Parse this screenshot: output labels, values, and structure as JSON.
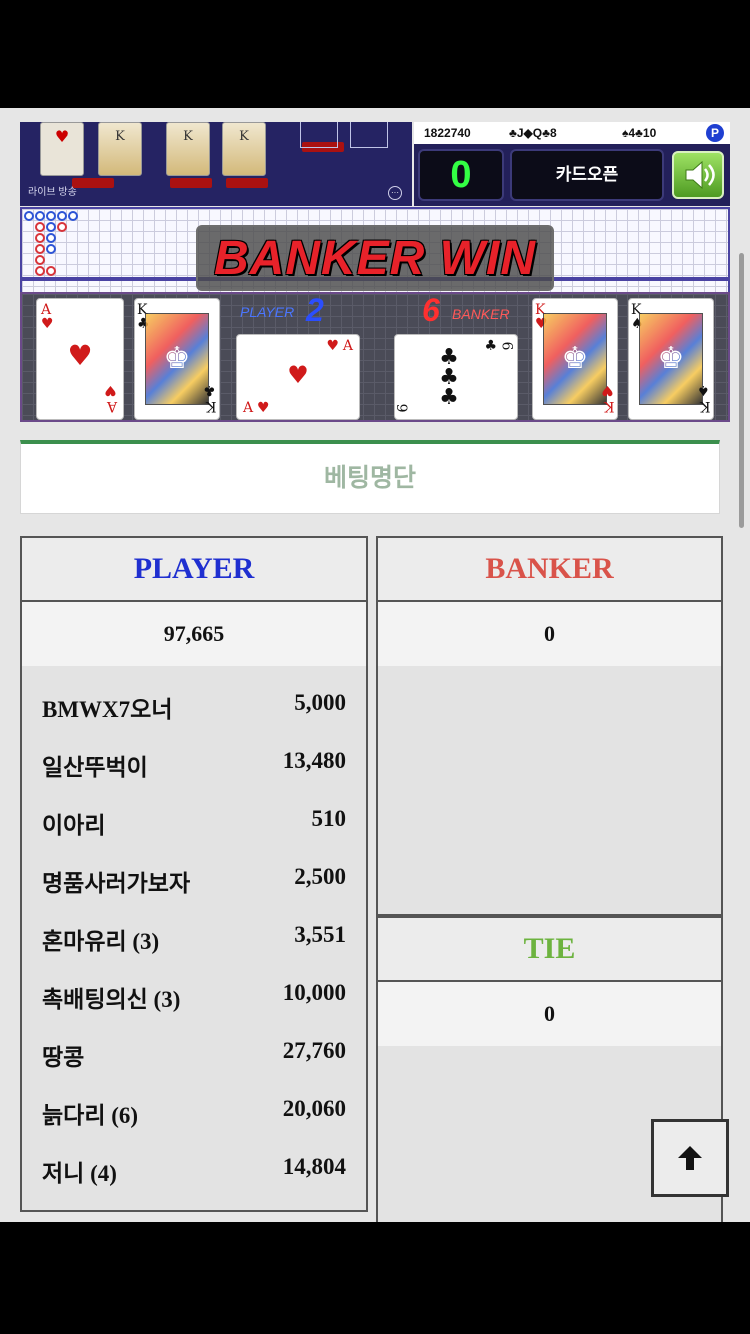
{
  "game": {
    "broadcast_label": "라이브 방송",
    "round_id": "1822740",
    "history_1": "♣J◆Q♣8",
    "history_2": "♠4♣10",
    "p_badge": "P",
    "countdown": "0",
    "card_open_label": "카드오픈",
    "result_text": "BANKER WIN",
    "player_label": "PLAYER",
    "player_score": "2",
    "banker_label": "BANKER",
    "banker_score": "6",
    "player_cards": [
      {
        "rank": "A",
        "suit": "♥",
        "color": "#d01a1a"
      },
      {
        "rank": "K",
        "suit": "♣",
        "color": "#111111"
      },
      {
        "rank": "A",
        "suit": "♥",
        "color": "#d01a1a"
      }
    ],
    "banker_cards": [
      {
        "rank": "6",
        "suit": "♣",
        "color": "#111111"
      },
      {
        "rank": "K",
        "suit": "♥",
        "color": "#d01a1a"
      },
      {
        "rank": "K",
        "suit": "♠",
        "color": "#111111"
      }
    ]
  },
  "betting": {
    "title": "베팅명단",
    "player": {
      "header": "PLAYER",
      "color": "#1f2fd0",
      "total": "97,665",
      "entries": [
        {
          "name": "BMWX7오너",
          "amount": "5,000"
        },
        {
          "name": "일산뚜벅이",
          "amount": "13,480"
        },
        {
          "name": "이아리",
          "amount": "510"
        },
        {
          "name": "명품사러가보자",
          "amount": "2,500"
        },
        {
          "name": "혼마유리 (3)",
          "amount": "3,551"
        },
        {
          "name": "촉배팅의신 (3)",
          "amount": "10,000"
        },
        {
          "name": "땅콩",
          "amount": "27,760"
        },
        {
          "name": "늙다리 (6)",
          "amount": "20,060"
        },
        {
          "name": "저니 (4)",
          "amount": "14,804"
        }
      ]
    },
    "banker": {
      "header": "BANKER",
      "color": "#d9534a",
      "total": "0"
    },
    "tie": {
      "header": "TIE",
      "color": "#6db33f",
      "total": "0"
    }
  },
  "scroll_top_icon": "arrow-up-icon"
}
